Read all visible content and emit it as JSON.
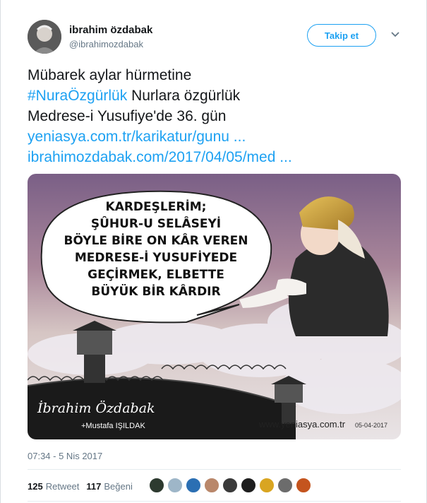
{
  "user": {
    "name": "ibrahim özdabak",
    "handle": "@ibrahimozdabak",
    "follow_label": "Takip et"
  },
  "tweet": {
    "line1": "Mübarek aylar hürmetine",
    "hashtag": "#NuraÖzgürlük",
    "line2_rest": " Nurlara özgürlük",
    "line3": "Medrese-i Yusufiye'de 36. gün",
    "link1": "yeniasya.com.tr/karikatur/gunu ...",
    "link2": "ibrahimozdabak.com/2017/04/05/med ..."
  },
  "cartoon": {
    "speech": [
      "KARDEŞLERİM;",
      "ŞÛHUR-U SELÂSEYİ",
      "BÖYLE BİRE ON KÂR VEREN",
      "MEDRESE-İ YUSUFİYEDE",
      "GEÇİRMEK, ELBETTE",
      "BÜYÜK BİR KÂRDIR"
    ],
    "signature": "İbrahim Özdabak",
    "credit": "+Mustafa IŞILDAK",
    "website": "www.yeniasya.com.tr",
    "date": "05-04-2017"
  },
  "timestamp": "07:34 - 5 Nis 2017",
  "stats": {
    "retweet_count": "125",
    "retweet_label": "Retweet",
    "like_count": "117",
    "like_label": "Beğeni"
  },
  "colors": {
    "accent": "#1da1f2",
    "muted": "#657786"
  }
}
